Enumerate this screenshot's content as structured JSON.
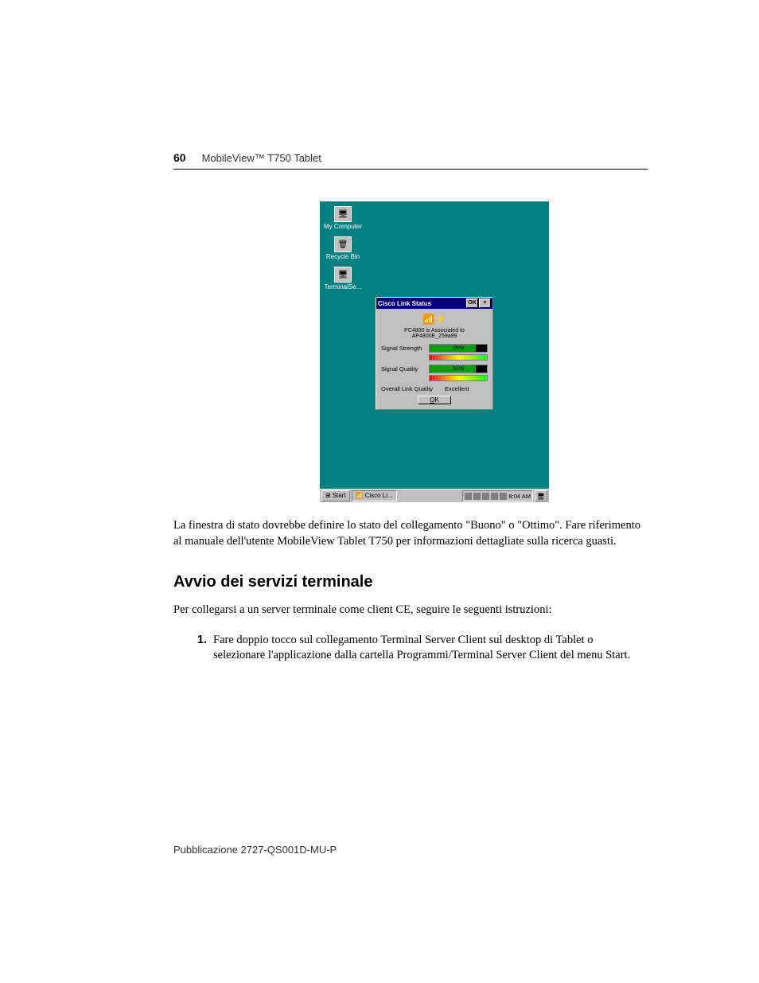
{
  "header": {
    "page_number": "60",
    "title": "MobileView™ T750 Tablet"
  },
  "screenshot": {
    "desktop_icons": [
      {
        "label": "My Computer",
        "glyph": "🖥"
      },
      {
        "label": "Recycle Bin",
        "glyph": "🗑"
      },
      {
        "label": "TerminalSe...",
        "glyph": "🖥"
      }
    ],
    "dialog": {
      "title": "Cisco Link Status",
      "ok_cap": "OK",
      "close_cap": "×",
      "assoc_text": "PC4800 is Associated to AP4800E_259a99",
      "signal_strength_label": "Signal Strength",
      "signal_strength_value": "86%",
      "signal_quality_label": "Signal Quality",
      "signal_quality_value": "81%",
      "overall_label": "Overall Link Quality",
      "overall_value": "Excellent",
      "ok_button": "OK"
    },
    "taskbar": {
      "start": "Start",
      "task_item": "Cisco Li...",
      "clock": "8:04 AM"
    }
  },
  "chart_data": {
    "type": "bar",
    "title": "Cisco Link Status",
    "categories": [
      "Signal Strength",
      "Signal Quality"
    ],
    "values": [
      86,
      81
    ],
    "ylim": [
      0,
      100
    ],
    "overall": "Excellent"
  },
  "body": {
    "paragraph": "La finestra di stato dovrebbe definire lo stato del collegamento \"Buono\" o \"Ottimo\". Fare riferimento al manuale dell'utente MobileView Tablet T750 per informazioni dettagliate sulla ricerca guasti.",
    "section_heading": "Avvio dei servizi terminale",
    "instruction": "Per collegarsi a un server terminale come client CE, seguire le seguenti istruzioni:",
    "step1": "Fare doppio tocco sul collegamento Terminal Server Client sul desktop di Tablet o selezionare l'applicazione dalla cartella Programmi/Terminal Server Client del menu Start."
  },
  "footer": {
    "publication": "Pubblicazione 2727-QS001D-MU-P"
  }
}
